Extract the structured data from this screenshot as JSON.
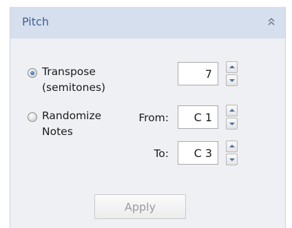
{
  "panel": {
    "title": "Pitch",
    "collapse_icon": "double-chevron-up-icon"
  },
  "transpose": {
    "label_line1": "Transpose",
    "label_line2": "(semitones)",
    "selected": true,
    "value": "7"
  },
  "randomize": {
    "label_line1": "Randomize",
    "label_line2": "Notes",
    "selected": false,
    "from_label": "From:",
    "from_value": "C 1",
    "to_label": "To:",
    "to_value": "C 3"
  },
  "apply_button": {
    "label": "Apply",
    "enabled": false
  },
  "colors": {
    "header_bg": "#d6dfed",
    "header_text": "#3c5f97",
    "panel_bg": "#eef0f3",
    "arrow_blue": "#4a6fa5"
  }
}
